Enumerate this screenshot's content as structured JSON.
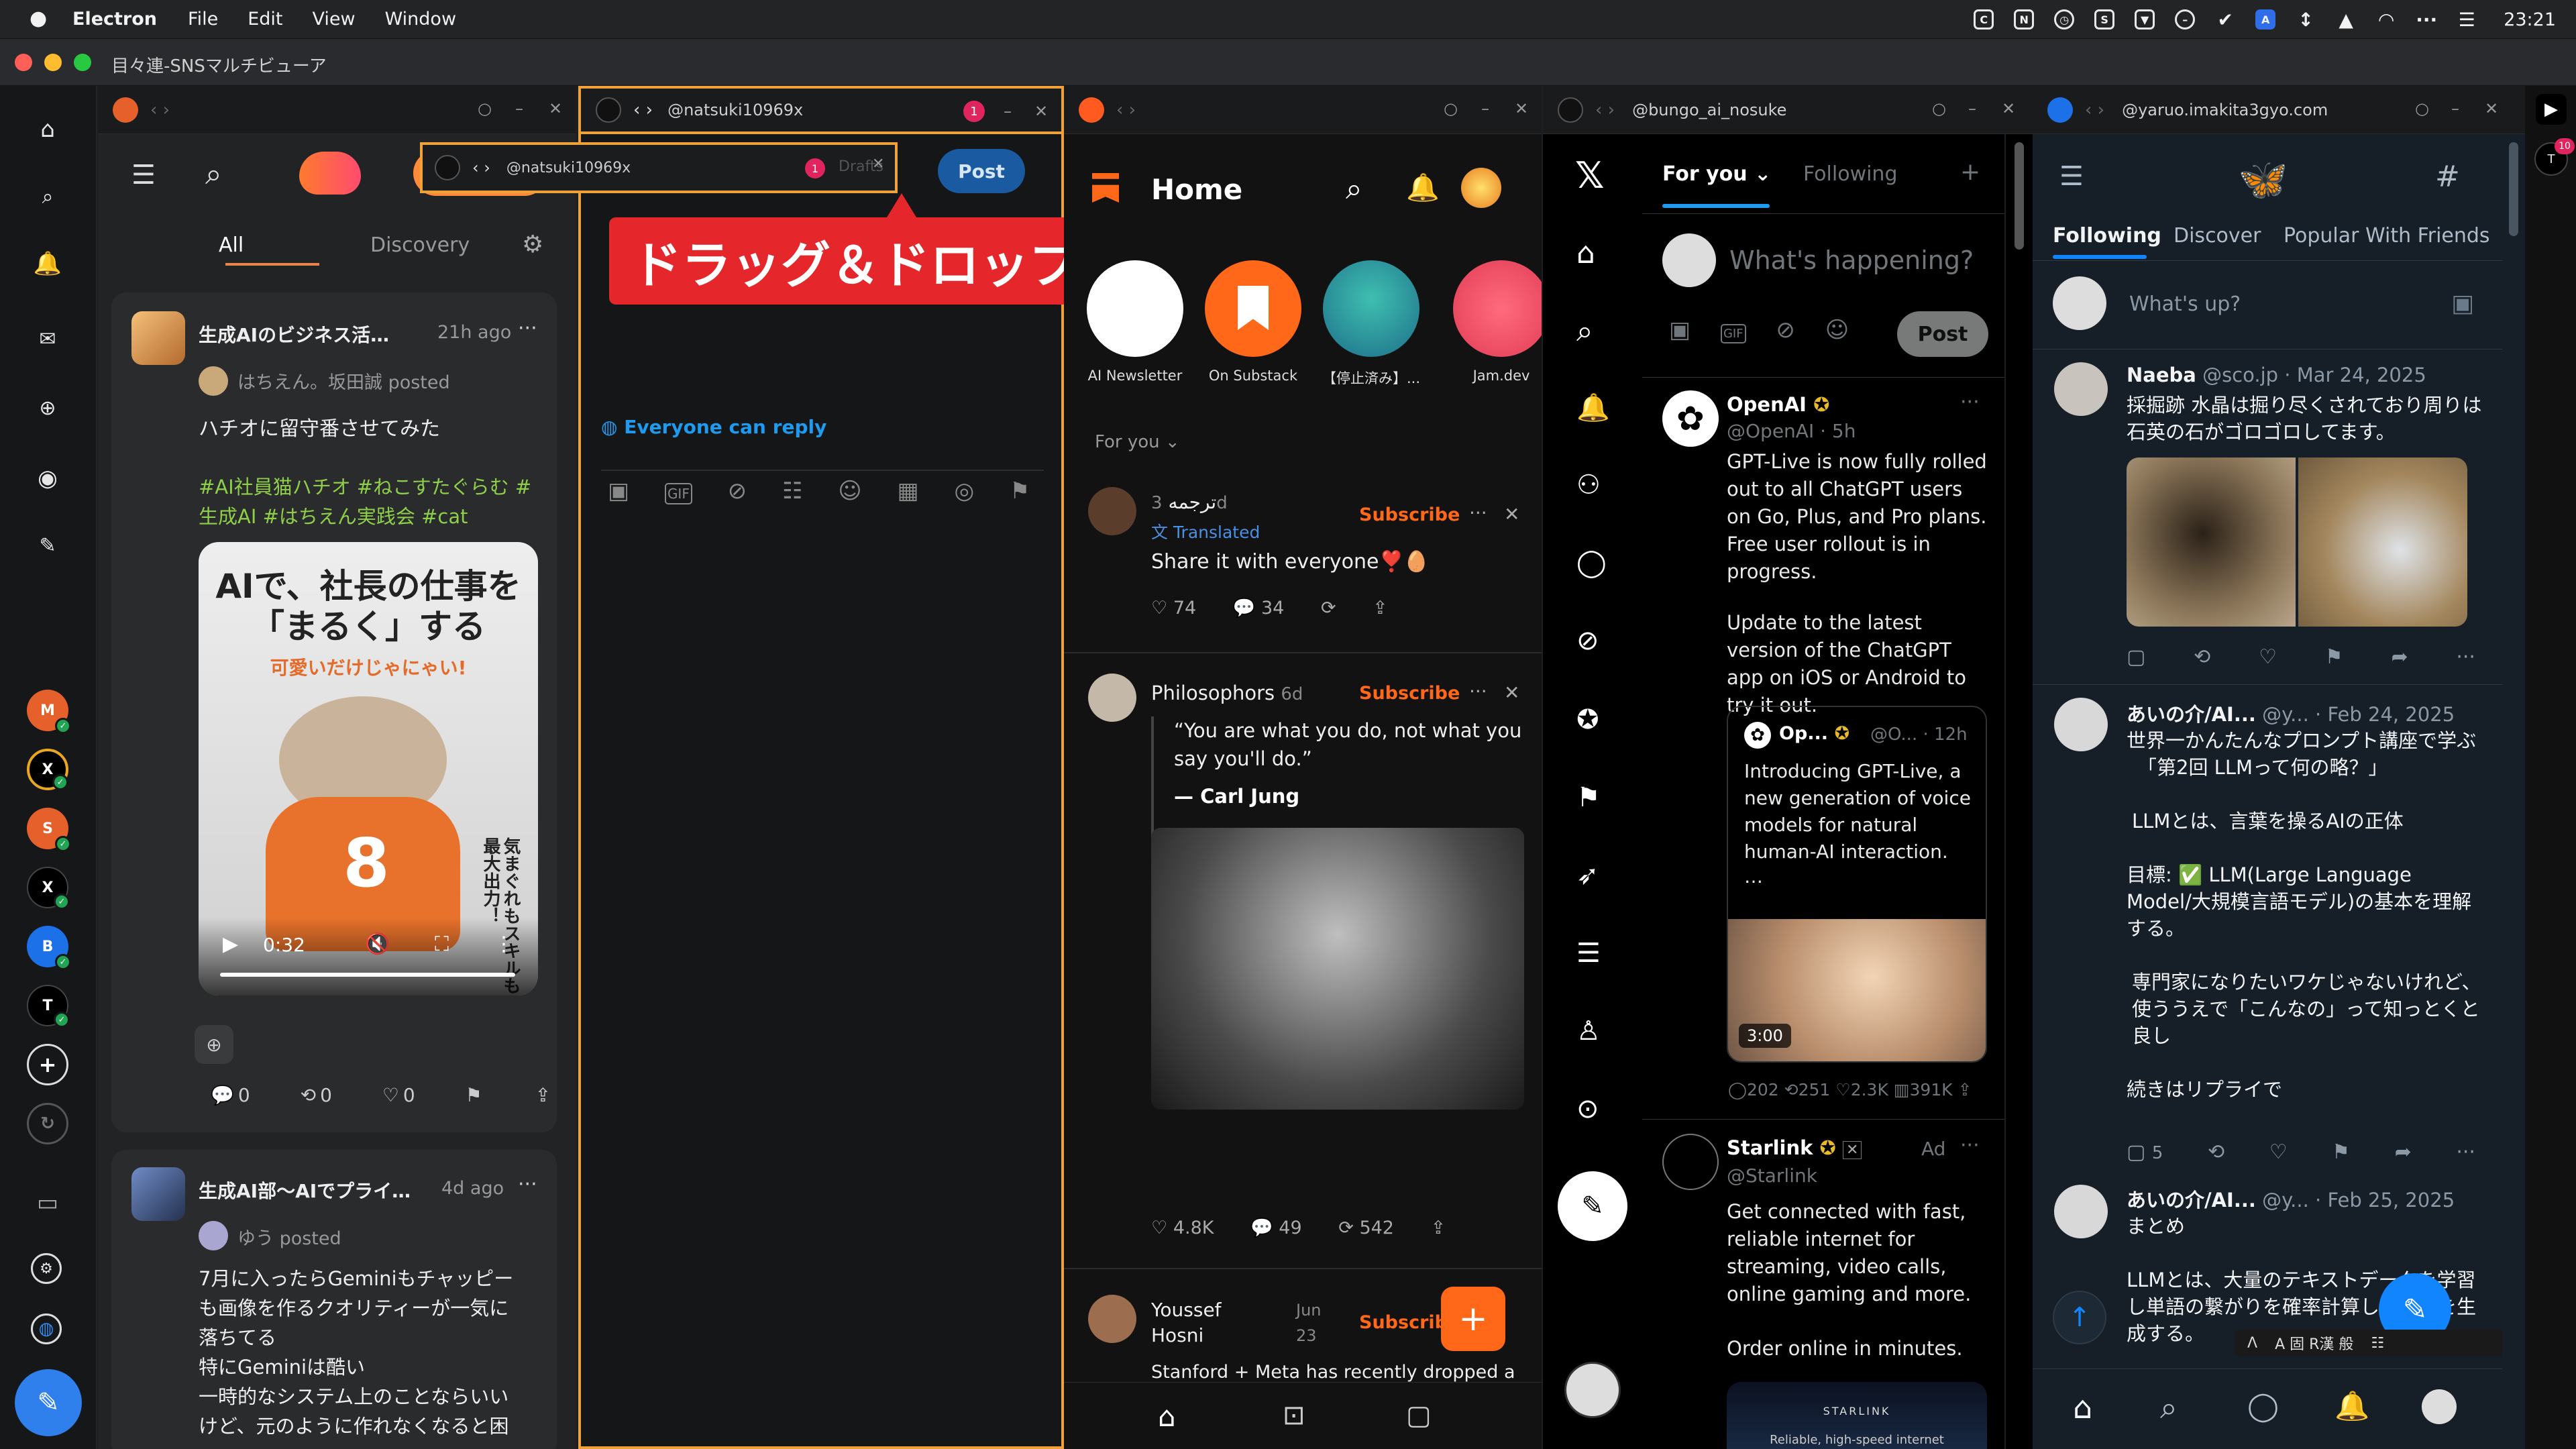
{
  "menubar": {
    "app": "Electron",
    "items": [
      "File",
      "Edit",
      "View",
      "Window"
    ],
    "clock": "23:21"
  },
  "window": {
    "title": "目々連-SNSマルチビューア"
  },
  "sidebar": {
    "accounts": [
      {
        "letter": "M",
        "color": "#e5602b"
      },
      {
        "letter": "X",
        "color": "#000000"
      },
      {
        "letter": "S",
        "color": "#e5602b"
      },
      {
        "letter": "X",
        "color": "#000000"
      },
      {
        "letter": "B",
        "color": "#1d71e8"
      },
      {
        "letter": "T",
        "color": "#000000"
      }
    ],
    "badge": "10"
  },
  "columns": {
    "col2": {
      "title": "@natsuki10969x",
      "badge": "1"
    },
    "col4": {
      "title": "@bungo_ai_nosuke"
    },
    "col5": {
      "title": "@yaruo.imakita3gyo.com"
    },
    "drag": {
      "title": "@natsuki10969x",
      "badge": "1",
      "draft": "Drafts"
    },
    "tooltip": "ドラッグ＆ドロップで並替え"
  },
  "misskey": {
    "tabs": [
      "All",
      "Discovery"
    ],
    "post_label": "Post",
    "posts": [
      {
        "channel": "生成AIのビジネス活…",
        "time": "21h ago",
        "by": "はちえん。坂田誠 posted",
        "text": "ハチオに留守番させてみた",
        "tags": "#AI社員猫ハチオ #ねこすたぐらむ #生成AI #はちえん実践会 #cat",
        "video": {
          "headline": "AIで、社長の仕事を「まるく」する",
          "sub": "可愛いだけじゃにゃい!",
          "side": "気まぐれもスキルも最大出力！",
          "number": "8",
          "time": "0:32"
        },
        "stats": [
          "0",
          "0",
          "0"
        ]
      },
      {
        "channel": "生成AI部～AIでプライ…",
        "time": "4d ago",
        "by": "ゆう posted",
        "lines": [
          "7月に入ったらGeminiもチャッピー",
          "も画像を作るクオリティーが一気に",
          "落ちてる",
          "特にGeminiは酷い",
          "一時的なシステム上のことならいい",
          "けど、元のように作れなくなると困"
        ]
      }
    ]
  },
  "bluesky_col2": {
    "reply": "Everyone can reply"
  },
  "substack": {
    "title": "Home",
    "stories": [
      "AI Newsletter",
      "On Substack",
      "【停止済み】...",
      "Jam.dev"
    ],
    "feed_label": "For you",
    "subscribe": "Subscribe",
    "posts": [
      {
        "name": "ترجمه",
        "time": "3d",
        "translated": "Translated",
        "text": "Share it with everyone❣️🥚",
        "likes": "74",
        "comments": "34"
      },
      {
        "name": "Philosophors",
        "time": "6d",
        "quote": "“You are what you do, not what you say you'll do.”",
        "author": "— Carl Jung",
        "likes": "4.8K",
        "comments": "49",
        "restacks": "542"
      },
      {
        "name": "Youssef Hosni",
        "time": "Jun 23",
        "text": "Stanford + Meta has recently dropped a"
      }
    ]
  },
  "x": {
    "tabs": [
      "For you",
      "Following"
    ],
    "compose": "What's happening?",
    "post": "Post",
    "tweets": [
      {
        "name": "OpenAI",
        "handle": "@OpenAI · 5h",
        "text1": "GPT-Live is now fully rolled out to all ChatGPT users on Go, Plus, and Pro plans. Free user rollout is in progress.",
        "text2": "Update to the latest version of the ChatGPT app on iOS or Android to try it out.",
        "quote": {
          "name": "Op...",
          "handle": "@O...",
          "time": "12h",
          "text": "Introducing GPT-Live, a new generation of voice models for natural human-AI interaction.",
          "more": "…",
          "duration": "3:00"
        },
        "stats": [
          "202",
          "251",
          "2.3K",
          "391K"
        ]
      },
      {
        "name": "Starlink",
        "handle": "@Starlink",
        "ad": "Ad",
        "text1": "Get connected with fast, reliable internet for streaming, video calls, online gaming and more.",
        "text2": "Order online in minutes.",
        "card": [
          "STARLINK",
          "Reliable, high-speed internet"
        ]
      }
    ]
  },
  "bluesky": {
    "tabs": [
      "Following",
      "Discover",
      "Popular With Friends"
    ],
    "compose": "What's up?",
    "posts": [
      {
        "name": "Naeba",
        "handle": "@sco.jp",
        "date": "Mar 24, 2025",
        "text": "採掘跡 水晶は掘り尽くされており周りは石英の石がゴロゴロしてます。"
      },
      {
        "name": "あいの介/AI...",
        "handle": "@y...",
        "date": "Feb 24, 2025",
        "lines": [
          "世界一かんたんなプロンプト講座で学ぶ",
          "「第2回 LLMって何の略？」",
          "",
          "LLMとは、言葉を操るAIの正体",
          "",
          "目標: ✅ LLM(Large Language Model/大規模言語モデル)の基本を理解する。",
          "",
          "専門家になりたいワケじゃないけれど、使ううえで「こんなの」って知っとくと良し",
          "",
          "続きはリプライで"
        ],
        "replies": "5"
      },
      {
        "name": "あいの介/AI...",
        "handle": "@y...",
        "date": "Feb 25, 2025",
        "lines": [
          "まとめ",
          "",
          "LLMとは、大量のテキストデータを学習し単語の繋がりを確率計算して文章を生成する。"
        ]
      }
    ],
    "ime": "A 固 R漢 般"
  }
}
